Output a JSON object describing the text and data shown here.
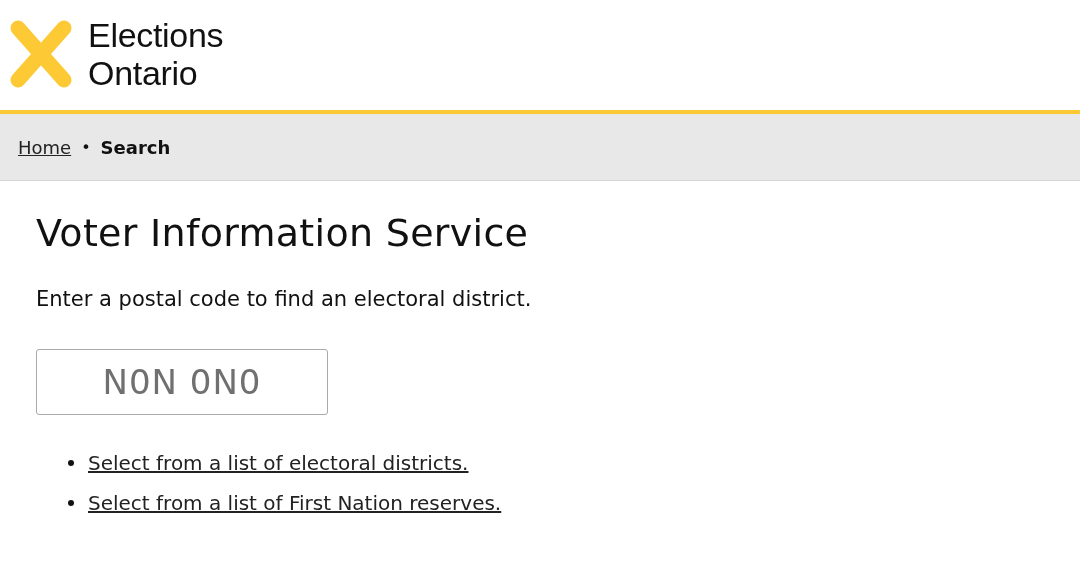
{
  "logo": {
    "line_1": "Elections",
    "line_2": "Ontario"
  },
  "breadcrumb": [
    {
      "label": "Home",
      "kind": "link"
    },
    {
      "label": "Search",
      "kind": "current"
    }
  ],
  "separator": "•",
  "title": "Voter Information Service",
  "instruction": "Enter a postal code to find an electoral district.",
  "postal_code_field": {
    "placeholder": "N0N 0N0"
  },
  "links": [
    "Select from a list of electoral districts.",
    "Select from a list of First Nation reserves."
  ]
}
